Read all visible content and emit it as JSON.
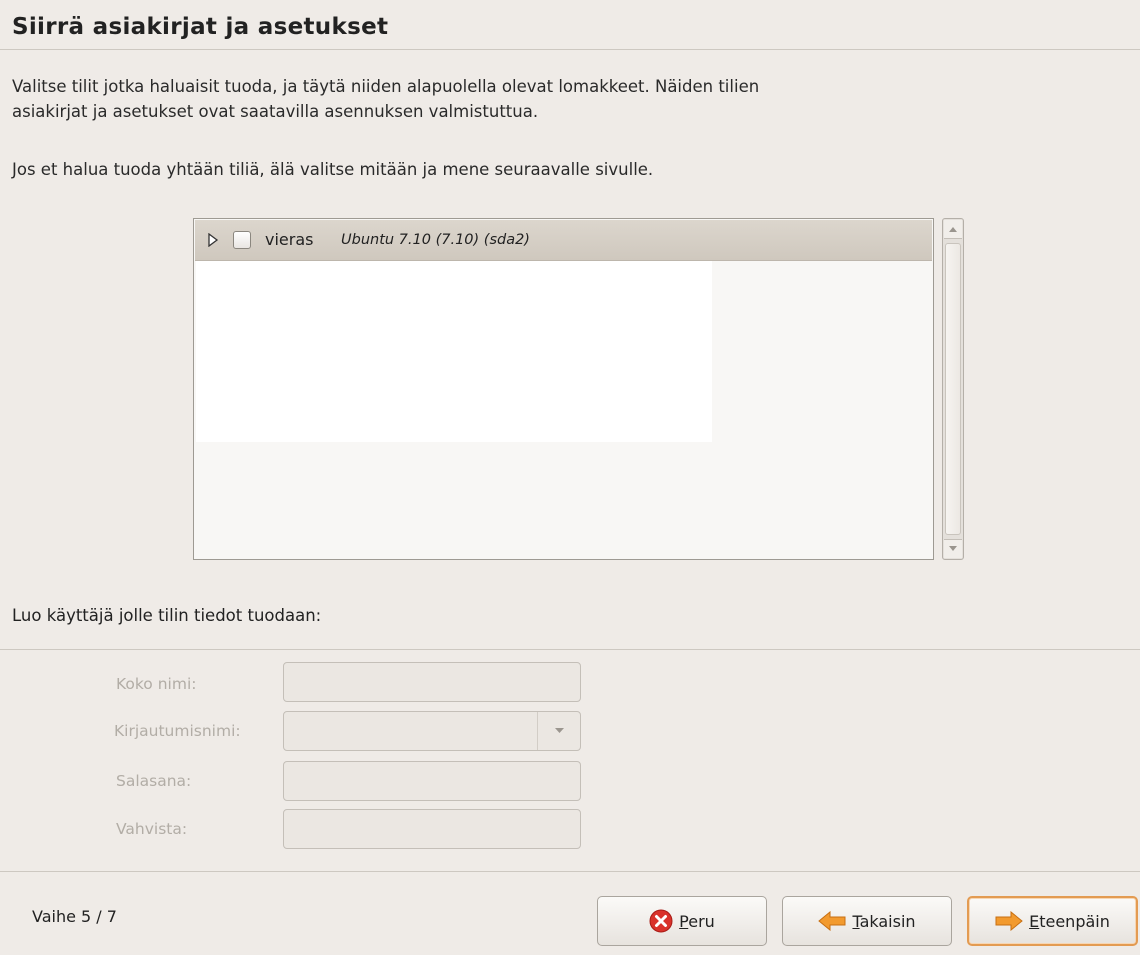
{
  "page": {
    "title": "Siirrä asiakirjat ja asetukset",
    "description_line1": "Valitse tilit jotka haluaisit tuoda, ja täytä niiden alapuolella olevat lomakkeet. Näiden tilien",
    "description_line2": "asiakirjat ja asetukset ovat saatavilla asennuksen valmistuttua.",
    "description_skip": "Jos et halua tuoda yhtään tiliä, älä valitse mitään ja mene seuraavalle sivulle."
  },
  "accounts": [
    {
      "name": "vieras",
      "detail": "Ubuntu 7.10 (7.10) (sda2)",
      "checked": false,
      "expanded": false
    }
  ],
  "form": {
    "heading": "Luo käyttäjä jolle tilin tiedot tuodaan:",
    "full_name_label": "Koko nimi:",
    "full_name_value": "",
    "username_label": "Kirjautumisnimi:",
    "username_value": "",
    "password_label": "Salasana:",
    "password_value": "",
    "confirm_label": "Vahvista:",
    "confirm_value": ""
  },
  "footer": {
    "step": "Vaihe 5 / 7",
    "cancel_first": "P",
    "cancel_rest": "eru",
    "back_first": "T",
    "back_rest": "akaisin",
    "forward_first": "E",
    "forward_rest": "teenpäin"
  },
  "colors": {
    "background": "#efebe7",
    "default_button_border": "#e39b52",
    "cancel_icon": "#d9322b",
    "arrow_icon": "#f29a2e"
  },
  "icons": [
    "expander-triangle-icon",
    "cancel-icon",
    "back-arrow-icon",
    "forward-arrow-icon",
    "scroll-up-icon",
    "scroll-down-icon",
    "dropdown-icon"
  ]
}
